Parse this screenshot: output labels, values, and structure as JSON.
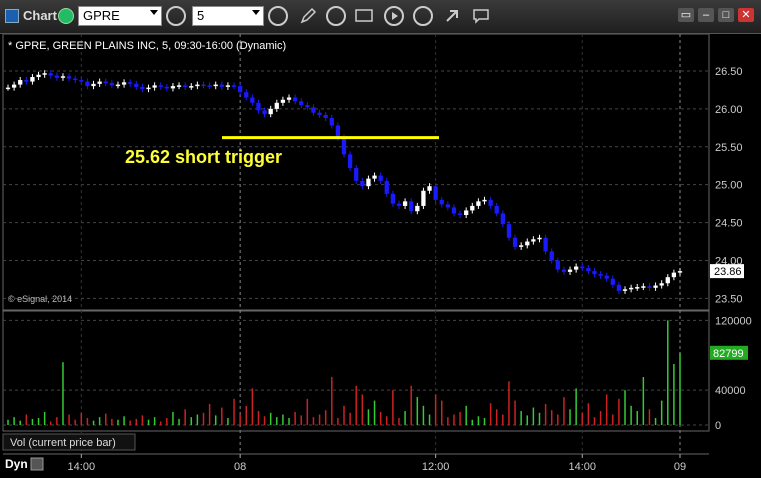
{
  "toolbar": {
    "app_label": "Chart",
    "symbol": "GPRE",
    "interval": "5"
  },
  "chart": {
    "header": "* GPRE, GREEN PLAINS INC, 5, 09:30-16:00 (Dynamic)",
    "annotation": "25.62 short trigger",
    "trigger_price": 25.62,
    "last_price_label": "23.86",
    "last_volume_label": "82799",
    "copyright": "© eSignal, 2014",
    "volume_panel_label": "Vol (current price bar)",
    "dyn_label": "Dyn",
    "colors": {
      "up": "#ffffff",
      "down": "#1a1aff",
      "trigger": "#ffff00",
      "vol_up": "#33cc33",
      "vol_down": "#cc2222",
      "price_tag": "#ffffff",
      "vol_tag": "#22aa22"
    }
  },
  "chart_data": [
    {
      "type": "candlestick",
      "title": "* GPRE, GREEN PLAINS INC, 5, 09:30-16:00 (Dynamic)",
      "y_ticks": [
        "26.50",
        "26.00",
        "25.50",
        "25.00",
        "24.50",
        "24.00",
        "23.50"
      ],
      "ylim": [
        23.4,
        26.75
      ],
      "x_ticks": [
        "14:00",
        "08",
        "12:00",
        "14:00",
        "09"
      ],
      "grid": true,
      "series": [
        {
          "name": "price",
          "close": [
            26.28,
            26.32,
            26.38,
            26.36,
            26.42,
            26.45,
            26.47,
            26.44,
            26.41,
            26.43,
            26.4,
            26.38,
            26.36,
            26.3,
            26.33,
            26.36,
            26.34,
            26.31,
            26.32,
            26.35,
            26.33,
            26.29,
            26.26,
            26.28,
            26.31,
            26.29,
            26.27,
            26.3,
            26.31,
            26.29,
            26.3,
            26.32,
            26.31,
            26.3,
            26.32,
            26.29,
            26.31,
            26.3,
            26.22,
            26.15,
            26.08,
            25.98,
            25.93,
            26.0,
            26.08,
            26.12,
            26.15,
            26.1,
            26.05,
            26.02,
            25.95,
            25.92,
            25.88,
            25.78,
            25.62,
            25.4,
            25.22,
            25.05,
            24.98,
            25.08,
            25.12,
            25.05,
            24.88,
            24.75,
            24.72,
            24.78,
            24.65,
            24.72,
            24.92,
            24.98,
            24.8,
            24.74,
            24.7,
            24.62,
            24.6,
            24.66,
            24.72,
            24.78,
            24.8,
            24.72,
            24.62,
            24.48,
            24.3,
            24.18,
            24.2,
            24.25,
            24.28,
            24.3,
            24.12,
            24.0,
            23.88,
            23.85,
            23.88,
            23.92,
            23.9,
            23.86,
            23.82,
            23.8,
            23.76,
            23.68,
            23.6,
            23.62,
            23.64,
            23.65,
            23.66,
            23.64,
            23.67,
            23.7,
            23.78,
            23.84,
            23.86
          ]
        },
        {
          "name": "volume",
          "values": [
            6000,
            9000,
            5000,
            12000,
            7000,
            8000,
            15000,
            4000,
            9000,
            72000,
            12000,
            6000,
            14000,
            8000,
            5000,
            9000,
            13000,
            7000,
            6000,
            10000,
            5000,
            7000,
            11000,
            6000,
            9000,
            4000,
            8000,
            15000,
            7000,
            18000,
            9000,
            12000,
            14000,
            24000,
            11000,
            20000,
            8000,
            30000,
            12000,
            22000,
            42000,
            16000,
            10000,
            14000,
            9000,
            12000,
            8000,
            15000,
            11000,
            30000,
            9000,
            12000,
            17000,
            55000,
            8000,
            22000,
            14000,
            45000,
            35000,
            18000,
            28000,
            15000,
            10000,
            40000,
            8000,
            16000,
            45000,
            32000,
            22000,
            12000,
            35000,
            28000,
            9000,
            12000,
            15000,
            22000,
            6000,
            10000,
            8000,
            25000,
            18000,
            12000,
            50000,
            28000,
            16000,
            11000,
            20000,
            14000,
            24000,
            17000,
            12000,
            32000,
            18000,
            42000,
            14000,
            25000,
            9000,
            16000,
            35000,
            12000,
            30000,
            40000,
            22000,
            16000,
            55000,
            18000,
            8000,
            28000,
            120000,
            70000,
            82799
          ]
        }
      ]
    }
  ]
}
